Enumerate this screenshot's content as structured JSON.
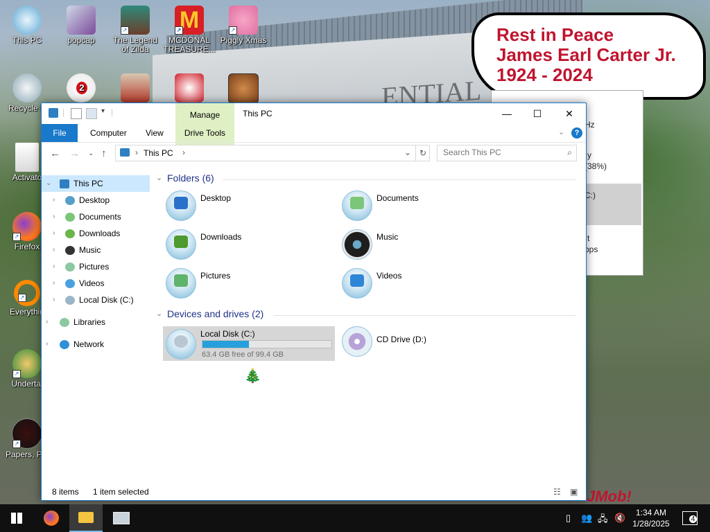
{
  "desktop": {
    "icons": [
      {
        "label": "This PC"
      },
      {
        "label": "popcap"
      },
      {
        "label": "The Legend of Zilda"
      },
      {
        "label": "MCDONAL TREASURE..."
      },
      {
        "label": "Piggly Xmas"
      },
      {
        "label": "Recycle B"
      },
      {
        "label": "Activato"
      },
      {
        "label": "Firefox"
      },
      {
        "label": "Everythin"
      },
      {
        "label": "Undertal"
      },
      {
        "label": "Papers, Ple"
      }
    ],
    "badge_number": "2",
    "memorial": {
      "line1": "Rest in Peace",
      "line2": "James Earl Carter Jr.",
      "line3": "1924 - 2024"
    },
    "background_window": {
      "row1": "Hz",
      "row2": "y",
      "row3": "(38%)",
      "row4": "C:)",
      "row5": "t",
      "row6": "bps"
    },
    "wallpaper_text": "ENTIAL",
    "wallpaper_sign": "JMob!"
  },
  "window": {
    "title": "This PC",
    "manage_tab": "Manage",
    "drive_tools_tab": "Drive Tools",
    "ribbon_tabs": {
      "file": "File",
      "computer": "Computer",
      "view": "View"
    },
    "address": {
      "location": "This PC"
    },
    "search": {
      "placeholder": "Search This PC"
    },
    "nav": {
      "this_pc": "This PC",
      "items": [
        "Desktop",
        "Documents",
        "Downloads",
        "Music",
        "Pictures",
        "Videos",
        "Local Disk (C:)"
      ],
      "libraries": "Libraries",
      "network": "Network"
    },
    "folders_group": "Folders (6)",
    "folders": [
      "Desktop",
      "Documents",
      "Downloads",
      "Music",
      "Pictures",
      "Videos"
    ],
    "devices_group": "Devices and drives (2)",
    "drives": {
      "c": {
        "name": "Local Disk (C:)",
        "free_text": "63.4 GB free of 99.4 GB",
        "used_fraction": 0.362
      },
      "d": {
        "name": "CD Drive (D:)"
      }
    },
    "status": {
      "items": "8 items",
      "selected": "1 item selected"
    }
  },
  "taskbar": {
    "time": "1:34 AM",
    "date": "1/28/2025",
    "notifications": "4"
  },
  "colors": {
    "accent": "#1979ca",
    "selection": "#cce8ff",
    "manage_bg": "#dff0c4",
    "bar_fill": "#26a0da"
  }
}
